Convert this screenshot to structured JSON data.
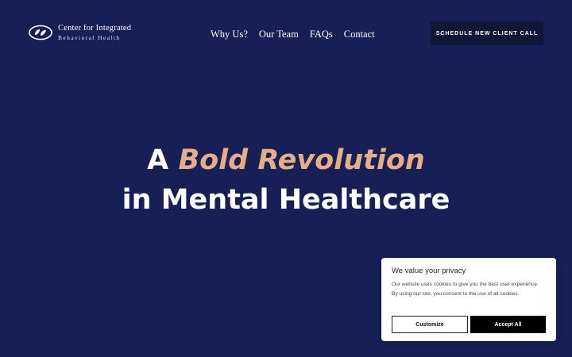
{
  "header": {
    "logo_line1": "Center for Integrated",
    "logo_line2": "Behavioral Health",
    "nav": [
      "Why Us?",
      "Our Team",
      "FAQs",
      "Contact"
    ],
    "cta_label": "SCHEDULE NEW CLIENT CALL"
  },
  "hero": {
    "line1_prefix": "A ",
    "line1_accent": "Bold Revolution",
    "line2": "in Mental Healthcare"
  },
  "cookie": {
    "title": "We value your privacy",
    "body": "Our website uses cookies to give you the best user experience. By using our site, you consent to the use of all cookies.",
    "customize_label": "Customize",
    "accept_label": "Accept All"
  },
  "colors": {
    "background": "#162056",
    "accent": "#e7ad86",
    "cta_background": "#0f1738"
  }
}
